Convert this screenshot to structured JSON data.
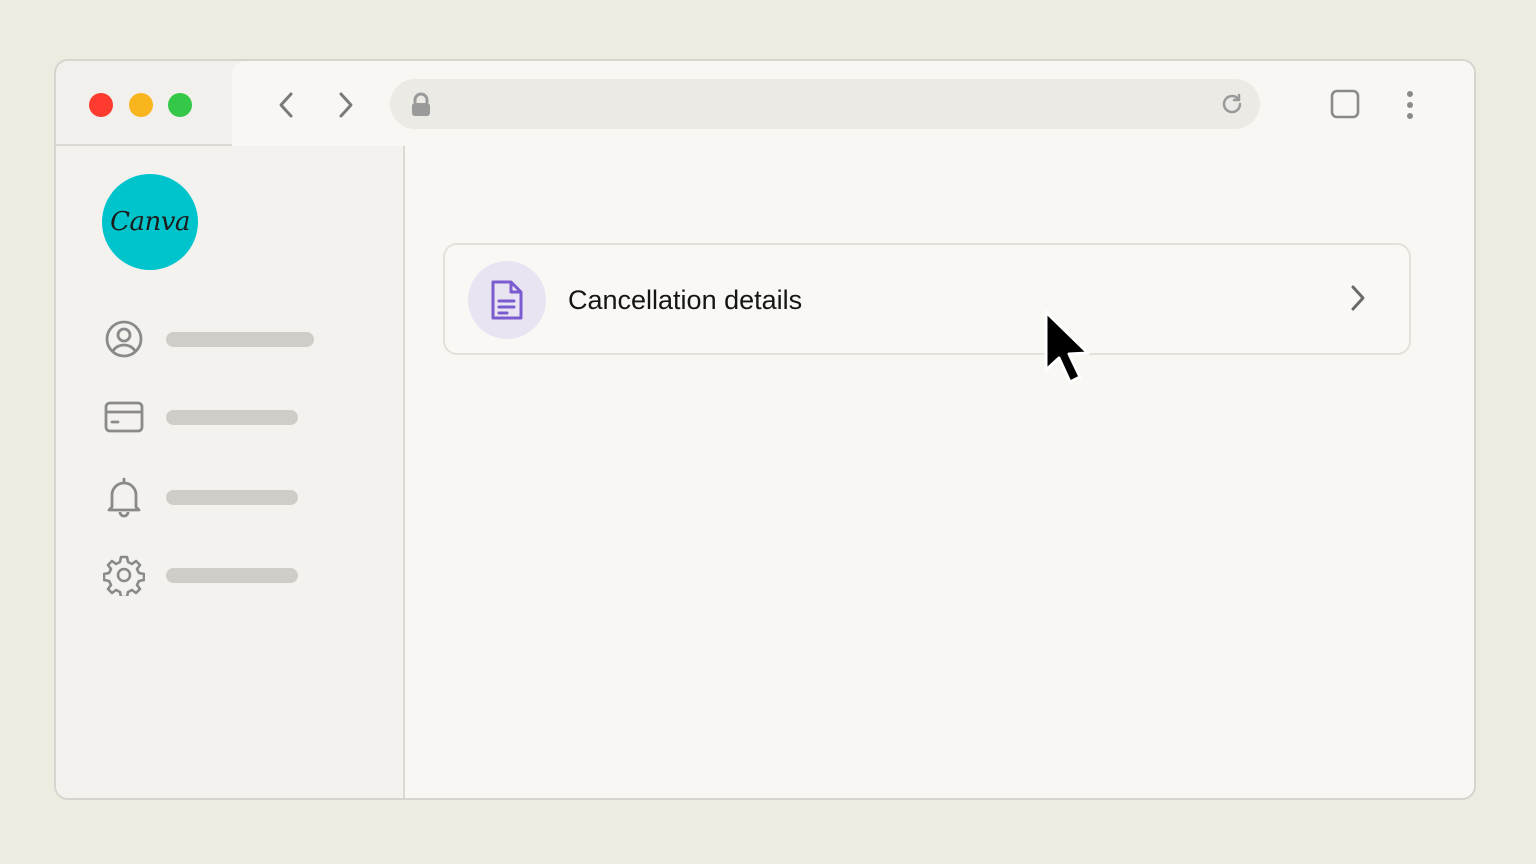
{
  "browser": {
    "url": "",
    "colors": {
      "close": "#ff3b30",
      "minimize": "#f8b51d",
      "maximize": "#34c748"
    }
  },
  "sidebar": {
    "logo_text": "Canva",
    "logo_color": "#00c4cc",
    "items": [
      {
        "icon": "account-icon"
      },
      {
        "icon": "credit-card-icon"
      },
      {
        "icon": "bell-icon"
      },
      {
        "icon": "gear-icon"
      }
    ]
  },
  "main": {
    "card": {
      "label": "Cancellation details",
      "icon": "document-icon",
      "icon_color": "#7a5cd0"
    }
  }
}
